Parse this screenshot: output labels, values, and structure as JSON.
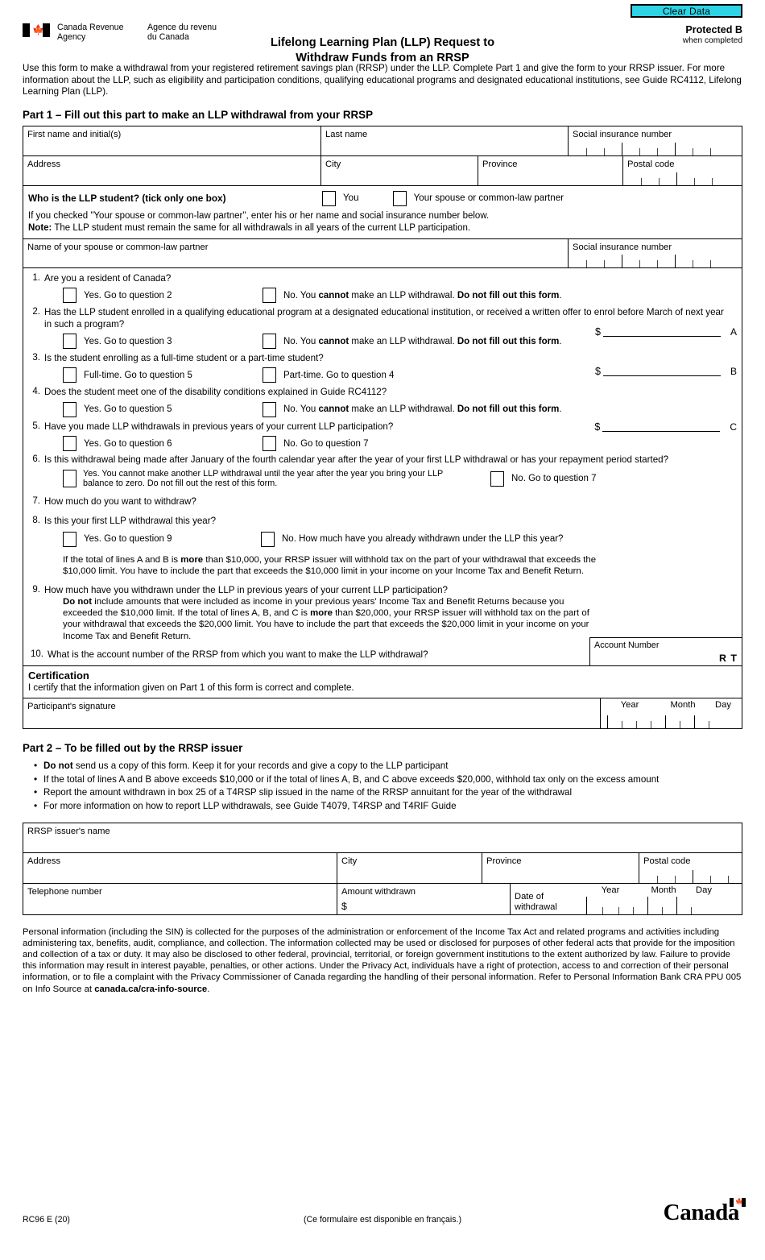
{
  "header": {
    "clear_data_label": "Clear Data",
    "cra_en": "Canada Revenue\nAgency",
    "cra_fr": "Agence du revenu\ndu Canada",
    "title_line1": "Lifelong Learning Plan (LLP) Request to",
    "title_line2": "Withdraw Funds from an RRSP",
    "protected_label": "Protected B",
    "protected_sub": "when completed"
  },
  "intro": "Use this form to make a withdrawal from your registered retirement savings plan (RRSP) under the LLP. Complete Part 1 and give the form to your RRSP issuer. For more information about the LLP, such as eligibility and participation conditions, qualifying educational programs and designated educational institutions, see Guide RC4112, Lifelong Learning Plan (LLP).",
  "part1": {
    "heading": "Part 1 – Fill out this part to make an LLP withdrawal from your RRSP",
    "fields": {
      "first_name": "First name and initial(s)",
      "last_name": "Last name",
      "sin": "Social insurance number",
      "address": "Address",
      "city": "City",
      "province": "Province",
      "postal_code": "Postal code",
      "spouse_name": "Name of your spouse or common-law partner",
      "spouse_sin": "Social insurance number"
    },
    "student": {
      "question": "Who is the LLP student? (tick only one box)",
      "option_you": "You",
      "option_spouse": "Your spouse or common-law partner",
      "instruction": "If you checked \"Your spouse or common-law partner\", enter his or her name and social insurance number below.",
      "note_label": "Note:",
      "note_text": " The LLP student must remain the same for all withdrawals in all years of the current LLP participation."
    },
    "questions": [
      {
        "num": "1.",
        "text": "Are you a resident of Canada?",
        "options": [
          {
            "text": "Yes. Go to question 2"
          },
          {
            "pre": "No. You ",
            "bold1": "cannot",
            "mid": " make an LLP withdrawal. ",
            "bold2": "Do not fill out this form",
            "post": "."
          }
        ]
      },
      {
        "num": "2.",
        "text": "Has the LLP student enrolled in a qualifying educational program at a designated educational institution, or received a written offer to enrol before March of next year in such a program?",
        "options": [
          {
            "text": "Yes. Go to question 3"
          },
          {
            "pre": "No. You ",
            "bold1": "cannot",
            "mid": " make an LLP withdrawal. ",
            "bold2": "Do not fill out this form",
            "post": "."
          }
        ]
      },
      {
        "num": "3.",
        "text": "Is the student enrolling as a full-time student or a part-time student?",
        "options": [
          {
            "text": "Full-time. Go to question 5"
          },
          {
            "text": "Part-time. Go to question 4"
          }
        ]
      },
      {
        "num": "4.",
        "text": "Does the student meet one of the disability conditions explained in Guide RC4112?",
        "options": [
          {
            "text": "Yes. Go to question 5"
          },
          {
            "pre": "No. You ",
            "bold1": "cannot",
            "mid": " make an LLP withdrawal. ",
            "bold2": "Do not fill out this form",
            "post": "."
          }
        ]
      },
      {
        "num": "5.",
        "text": "Have you made LLP withdrawals in previous years of your current LLP participation?",
        "options": [
          {
            "text": "Yes. Go to question 6"
          },
          {
            "text": "No. Go to question 7"
          }
        ]
      }
    ],
    "q6": {
      "num": "6.",
      "text": "Is this withdrawal being made after January of the fourth calendar year after the year of your first LLP withdrawal or has your repayment period started?",
      "yes_line1": "Yes. You cannot make another LLP withdrawal until the year after the year you bring your LLP",
      "yes_line2": "balance to zero. Do not fill out the rest of this form.",
      "no_text": "No. Go to question 7"
    },
    "q7": {
      "num": "7.",
      "text": "How much do you want to withdraw?",
      "dollar": "$",
      "letter": "A"
    },
    "q8": {
      "num": "8.",
      "text": "Is this your first LLP withdrawal this year?",
      "yes_text": "Yes. Go to question 9",
      "no_text": "No. How much have you already withdrawn under the LLP this year?",
      "dollar": "$",
      "letter": "B",
      "note_pre": "If the total of lines A and B is ",
      "note_bold": "more",
      "note_post": " than $10,000, your RRSP issuer will withhold tax on the part of your withdrawal that exceeds the $10,000 limit. You have to include the part that exceeds the $10,000 limit in your income on your Income Tax and Benefit Return."
    },
    "q9": {
      "num": "9.",
      "text": "How much have you withdrawn under the LLP in previous years of your current LLP participation?",
      "body_bold": "Do not",
      "body_pre": " include amounts that were included as income in your previous years' Income Tax and Benefit Returns because you exceeded the $10,000 limit. If the total of lines A, B, and C is ",
      "body_bold2": "more",
      "body_post": " than $20,000, your RRSP issuer will withhold tax on the part of your withdrawal that exceeds the $20,000 limit. You have to include the part that exceeds the $20,000 limit in your income on your Income Tax and Benefit Return.",
      "dollar": "$",
      "letter": "C"
    },
    "q10": {
      "num": "10.",
      "text": "What is the account number of the RRSP from which you want to make the LLP withdrawal?",
      "account_label": "Account Number",
      "account_suffix": "R T"
    },
    "certification": {
      "heading": "Certification",
      "text": "I certify that the information given on Part 1 of this form is correct and complete.",
      "signature_label": "Participant's signature",
      "year": "Year",
      "month": "Month",
      "day": "Day"
    }
  },
  "part2": {
    "heading": "Part 2 – To be filled out by the RRSP issuer",
    "bullets": [
      {
        "bold": "Do not",
        "text": " send us a copy of this form. Keep it for your records and give a copy to the LLP participant"
      },
      {
        "bold": "",
        "text": "If the total of lines A and B above exceeds $10,000 or if the total of lines A, B, and C above exceeds $20,000, withhold tax only on the excess amount"
      },
      {
        "bold": "",
        "text": "Report the amount withdrawn in box 25 of a T4RSP slip issued in the name of the RRSP annuitant for the year of the withdrawal"
      },
      {
        "bold": "",
        "text": "For more information on how to report LLP withdrawals, see Guide T4079, T4RSP and T4RIF Guide"
      }
    ],
    "fields": {
      "issuer_name": "RRSP issuer's name",
      "address": "Address",
      "city": "City",
      "province": "Province",
      "postal_code": "Postal code",
      "telephone": "Telephone number",
      "amount_withdrawn": "Amount withdrawn",
      "amount_dollar": "$",
      "date_line1": "Date of",
      "date_line2": "withdrawal",
      "year": "Year",
      "month": "Month",
      "day": "Day"
    }
  },
  "privacy": "Personal information (including the SIN) is collected for the purposes of the administration or enforcement of the Income Tax Act and related programs and activities including administering tax, benefits, audit, compliance, and collection. The information collected may be used or disclosed for purposes of other federal acts that provide for the imposition and collection of a tax or duty. It may also be disclosed to other federal, provincial, territorial, or foreign government institutions to the extent authorized by law. Failure to provide this information may result in interest payable, penalties, or other actions. Under the Privacy Act, individuals have a right of protection, access to and correction of their personal information, or to file a complaint with the Privacy Commissioner of Canada regarding the handling of their personal information. Refer to Personal Information Bank CRA PPU 005 on Info Source at ",
  "privacy_bold": "canada.ca/cra-info-source",
  "privacy_end": ".",
  "footer": {
    "form_code": "RC96 E (20)",
    "french_note": "(Ce formulaire est disponible en français.)",
    "wordmark": "Canada"
  },
  "colors": {
    "clear_data_bg": "#2ed4e6",
    "border": "#000000"
  }
}
